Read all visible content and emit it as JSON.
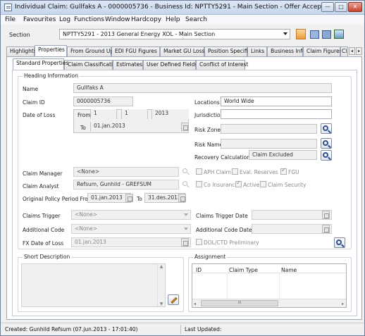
{
  "window": {
    "title": "Individual Claim: Gullfaks A - 0000005736 - Business Id: NPTTY5291 - Main Section - Offer Accepted",
    "minimize": "—",
    "maximize": "□",
    "close": "✕"
  },
  "menu": [
    "File",
    "Favourites",
    "Log",
    "Functions",
    "Window",
    "Hardcopy",
    "Help",
    "Search"
  ],
  "section": {
    "label": "Section",
    "value": "NPTTY5291 - 2013 General Energy XOL - Main Section"
  },
  "main_tabs": [
    "Highlights",
    "Properties",
    "From Ground Up",
    "EDI FGU Figures",
    "Market GU Loss",
    "Position Specific",
    "Links",
    "Business Info",
    "Claim Figures",
    "Cl"
  ],
  "sub_tabs": [
    "Standard Properties",
    "Claim Classification",
    "Estimates",
    "User Defined Fields",
    "Conflict of Interest"
  ],
  "heading": {
    "title": "Heading Information",
    "name_label": "Name",
    "name_value": "Gullfaks A",
    "claim_id_label": "Claim ID",
    "claim_id_value": "0000005736",
    "date_of_loss_label": "Date of Loss",
    "from_label": "From",
    "from_day": "1",
    "from_month": "1",
    "from_year": "2013",
    "to_label": "To",
    "to_value": "01.jan.2013",
    "locations_label": "Locations",
    "locations_value": "World Wide",
    "jurisdiction_label": "Jurisdiction",
    "jurisdiction_value": "",
    "risk_zone_label": "Risk Zone",
    "risk_name_label": "Risk Name",
    "recovery_label": "Recovery Calculation",
    "recovery_value": "Claim Excluded",
    "claim_manager_label": "Claim Manager",
    "claim_manager_value": "<None>",
    "claim_analyst_label": "Claim Analyst",
    "claim_analyst_value": "Refsum, Gunhild - GREFSUM",
    "policy_period_label": "Original Policy Period From",
    "policy_from": "01.jan.2013",
    "policy_to_label": "To",
    "policy_to": "31.des.2013",
    "claims_trigger_label": "Claims Trigger",
    "claims_trigger_value": "<None>",
    "claims_trigger_date_label": "Claims Trigger Date",
    "additional_code_label": "Additional Code",
    "additional_code_value": "<None>",
    "additional_code_date_label": "Additional Code Date",
    "fx_date_label": "FX Date of Loss",
    "fx_date_value": "01.jan.2013",
    "dol_ctd_label": "DOL/CTD Preliminary",
    "aph_claim": "APH Claim",
    "eval_reserves": "Eval. Reserves",
    "fgu": "FGU",
    "co_insurance": "Co Insurance",
    "active": "Active",
    "claim_security": "Claim Security"
  },
  "short_description": {
    "title": "Short Description",
    "text": ""
  },
  "assignment": {
    "title": "Assignment",
    "columns": [
      "ID",
      "Claim Type",
      "Name"
    ],
    "scroll_thumb": "III"
  },
  "status": {
    "created": "Created: Gunhild Refsum (07.jun.2013 - 17:01:40)",
    "last_updated": "Last Updated:"
  }
}
